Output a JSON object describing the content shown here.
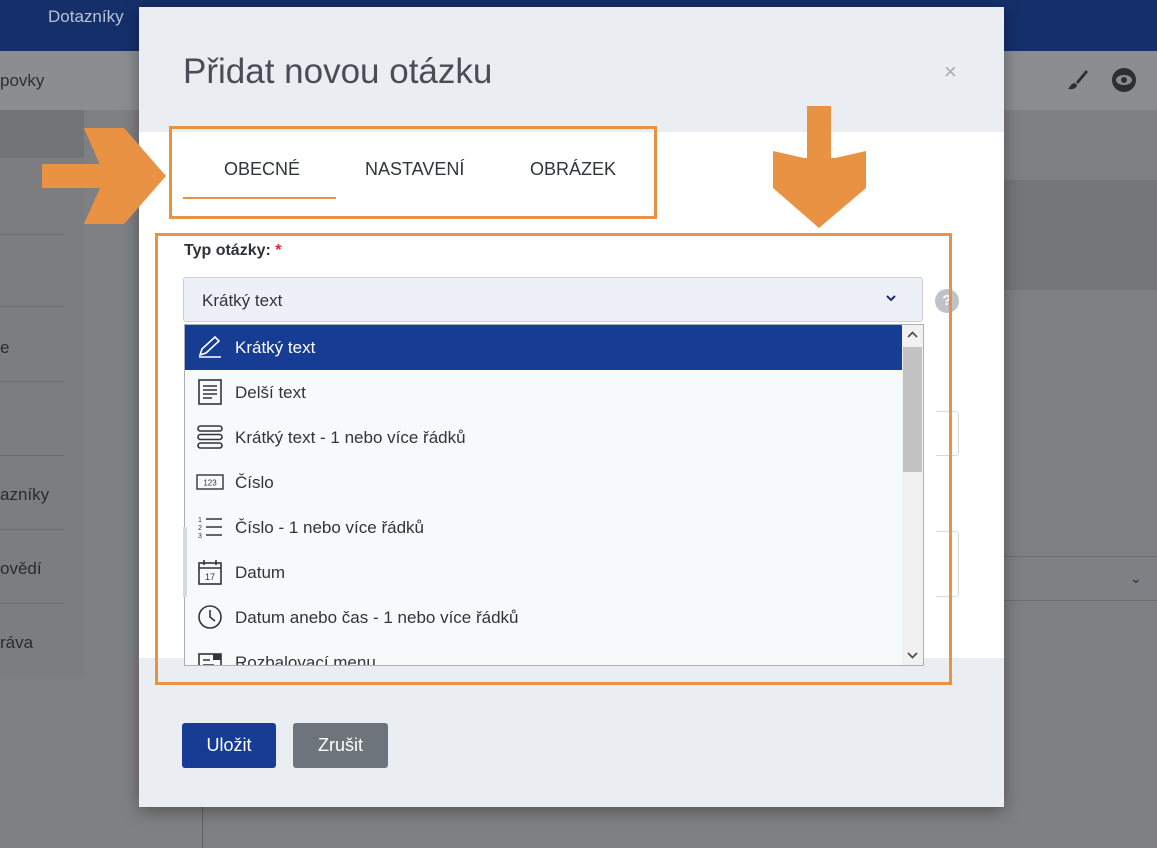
{
  "background": {
    "app_name": "Dotazníky",
    "breadcrumb_fragment": "povky",
    "sidebar_fragments": [
      "e",
      "azníky",
      "ovědí",
      "ráva"
    ],
    "toolbar_icons": [
      "paintbrush-icon",
      "eye-icon"
    ]
  },
  "modal": {
    "title": "Přidat novou otázku",
    "close_glyph": "×",
    "tabs": [
      {
        "label": "OBECNÉ",
        "active": true
      },
      {
        "label": "NASTAVENÍ",
        "active": false
      },
      {
        "label": "OBRÁZEK",
        "active": false
      }
    ],
    "question_type": {
      "label": "Typ otázky:",
      "required_mark": "*",
      "selected_value": "Krátký text",
      "help_glyph": "?",
      "options": [
        {
          "label": "Krátký text",
          "icon": "pen-icon",
          "selected": true
        },
        {
          "label": "Delší text",
          "icon": "document-lines-icon",
          "selected": false
        },
        {
          "label": "Krátký text - 1 nebo více řádků",
          "icon": "stacked-rows-icon",
          "selected": false
        },
        {
          "label": "Číslo",
          "icon": "number-123-icon",
          "selected": false
        },
        {
          "label": "Číslo - 1 nebo více řádků",
          "icon": "numbered-list-icon",
          "selected": false
        },
        {
          "label": "Datum",
          "icon": "calendar-icon",
          "selected": false
        },
        {
          "label": "Datum anebo čas - 1 nebo více řádků",
          "icon": "clock-icon",
          "selected": false
        },
        {
          "label": "Rozbalovací menu",
          "icon": "dropdown-menu-icon",
          "selected": false
        }
      ]
    },
    "buttons": {
      "save": "Uložit",
      "cancel": "Zrušit"
    }
  },
  "colors": {
    "primary": "#163c94",
    "annotation": "#e99244",
    "required": "#d9262f",
    "cancel_button": "#6d747c"
  }
}
